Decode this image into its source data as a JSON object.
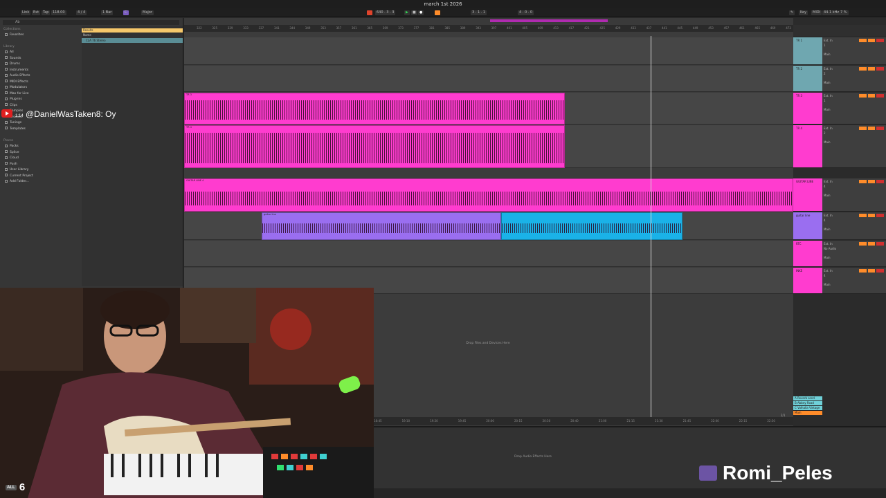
{
  "window": {
    "title": "march 1st 2026"
  },
  "transport": {
    "link": "Link",
    "ext": "Ext",
    "tap": "Tap",
    "tempo": "118.00",
    "signature": "4 / 4",
    "quant": "1 Bar",
    "key": "C",
    "scale": "Major",
    "position": "640 . 3 . 3",
    "loop_start": "3 . 1 . 1",
    "loop_len": "4 . 0 . 0",
    "key_label": "Key",
    "midi_label": "MIDI",
    "sample_rate": "44.1 kHz",
    "cpu": "7 %"
  },
  "browser": {
    "search_placeholder": "Ab",
    "collections_header": "Collections",
    "favorites": "Favorites",
    "library_header": "Library",
    "items": [
      "All",
      "Sounds",
      "Drums",
      "Instruments",
      "Audio Effects",
      "MIDI Effects",
      "Modulators",
      "Max for Live",
      "Plug-ins",
      "Clips",
      "Samples",
      "Grooves",
      "Tunings",
      "Templates"
    ],
    "places_header": "Places",
    "places": [
      "Packs",
      "Splice",
      "Cloud",
      "Push",
      "User Library",
      "Current Project",
      "Add Folder..."
    ],
    "results_header": "Results",
    "results_sub": "Name",
    "result_item": "CLA 76 Stereo"
  },
  "arrangement": {
    "ruler_ticks": [
      "322",
      "325",
      "329",
      "333",
      "337",
      "341",
      "344",
      "349",
      "353",
      "357",
      "361",
      "365",
      "369",
      "373",
      "377",
      "381",
      "385",
      "389",
      "393",
      "397",
      "401",
      "405",
      "409",
      "413",
      "417",
      "421",
      "425",
      "429",
      "433",
      "437",
      "441",
      "445",
      "449",
      "453",
      "457",
      "461",
      "465",
      "469",
      "473"
    ],
    "time_ticks": [
      "18:45",
      "19:10",
      "19:20",
      "19:45",
      "20:00",
      "20:15",
      "20:30",
      "20:40",
      "21:00",
      "21:15",
      "21:30",
      "21:45",
      "22:00",
      "22:15",
      "22:30"
    ],
    "drop_files": "Drop Files and Devices Here",
    "drop_audio_effects": "Drop Audio Effects Here",
    "page_indicator": "2/1"
  },
  "tracks": [
    {
      "name": "TR 1",
      "color": "#6fa7b0",
      "in": "Ext. In",
      "num": "1",
      "out": "Main"
    },
    {
      "name": "TR 2",
      "color": "#6fa7b0",
      "in": "Ext. In",
      "num": "2",
      "out": "Main"
    },
    {
      "name": "TR 3",
      "color": "#ff3ccf",
      "in": "Ext. In",
      "num": "1",
      "out": "Main",
      "clip": "TR 3"
    },
    {
      "name": "TR 4",
      "color": "#ff3ccf",
      "in": "Ext. In",
      "num": "2",
      "out": "Main",
      "clip": "TR 4"
    },
    {
      "name": "GUITAR LINE",
      "color": "#ff3ccf",
      "in": "Ext. In",
      "num": "4",
      "out": "Main",
      "clip": "GUITAR LINE 4"
    },
    {
      "name": "guitar line",
      "color": "#9a6ef0",
      "in": "Ext. In",
      "num": "4",
      "out": "Main",
      "clip": "guitar line"
    },
    {
      "name": "RTC",
      "color": "#ff3ccf",
      "in": "Ext. In",
      "num": "No Audio",
      "out": "Main"
    },
    {
      "name": "INKE",
      "color": "#ff3ccf",
      "in": "Ext. In",
      "num": "4",
      "out": "Main"
    }
  ],
  "returns": [
    "A Reverb send",
    "B Abbey Road",
    "C Valhalla Vintage",
    "Main"
  ],
  "stream": {
    "chat_user": "@DanielWasTaken8:",
    "chat_msg": "Oy",
    "chat_time": "1:14",
    "watermark": "Romi_Peles",
    "viewer_badge": "ALL",
    "viewer_count": "6"
  },
  "colors": {
    "pink": "#ff3ccf",
    "purple": "#9a6ef0",
    "cyan": "#1ab2e8",
    "teal": "#6fa7b0",
    "orange": "#ff8c2a"
  }
}
